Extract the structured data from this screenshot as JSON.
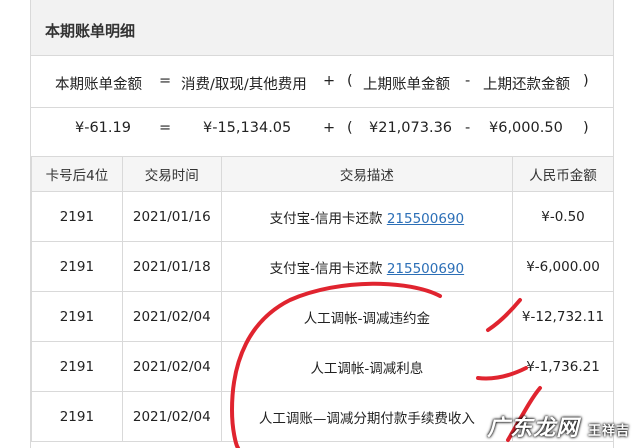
{
  "section_title": "本期账单明细",
  "formula": {
    "line1": {
      "current": "本期账单金额",
      "eq": "=",
      "spend": "消费/取现/其他费用",
      "plus": "+",
      "open": "(",
      "prev_bill": "上期账单金额",
      "minus": "-",
      "prev_repay": "上期还款金额",
      "close": ")"
    },
    "line2": {
      "current": "¥-61.19",
      "eq": "=",
      "spend": "¥-15,134.05",
      "plus": "+",
      "open": "(",
      "prev_bill": "¥21,073.36",
      "minus": "-",
      "prev_repay": "¥6,000.50",
      "close": ")"
    }
  },
  "table": {
    "headers": [
      "卡号后4位",
      "交易时间",
      "交易描述",
      "人民币金额"
    ],
    "rows": [
      {
        "card": "2191",
        "date": "2021/01/16",
        "desc": "支付宝-信用卡还款 ",
        "link": "215500690",
        "amount": "¥-0.50"
      },
      {
        "card": "2191",
        "date": "2021/01/18",
        "desc": "支付宝-信用卡还款 ",
        "link": "215500690",
        "amount": "¥-6,000.00"
      },
      {
        "card": "2191",
        "date": "2021/02/04",
        "desc": "人工调帐-调减违约金",
        "link": "",
        "amount": "¥-12,732.11"
      },
      {
        "card": "2191",
        "date": "2021/02/04",
        "desc": "人工调帐-调减利息",
        "link": "",
        "amount": "¥-1,736.21"
      },
      {
        "card": "2191",
        "date": "2021/02/04",
        "desc": "人工调账—调减分期付款手续费收入",
        "link": "",
        "amount": ""
      }
    ]
  },
  "watermark": {
    "main": "广东龙网",
    "sub": "王祥吉"
  },
  "colors": {
    "scribble": "#e0242f",
    "link": "#2c6fb7",
    "header_bg": "#f2f2f2"
  }
}
